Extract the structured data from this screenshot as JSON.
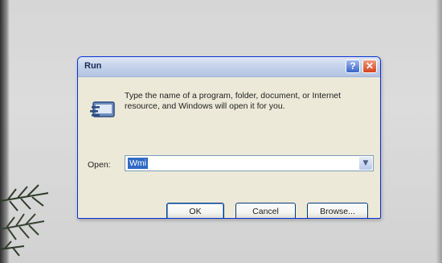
{
  "dialog": {
    "title": "Run",
    "help_button": "?",
    "close_button": "✕",
    "description": "Type the name of a program, folder, document, or Internet resource, and Windows will open it for you.",
    "open_label": "Open:",
    "open_value": "Wmi",
    "buttons": {
      "ok": "OK",
      "cancel": "Cancel",
      "browse": "Browse..."
    }
  },
  "colors": {
    "titlebar": "#c6d3ea",
    "dialog_bg": "#ece9d8",
    "close_red": "#d2431c",
    "help_blue": "#3b64c9",
    "selection": "#316ac5"
  },
  "icons": [
    "run-icon",
    "help-icon",
    "close-icon",
    "dropdown-arrow-icon"
  ]
}
